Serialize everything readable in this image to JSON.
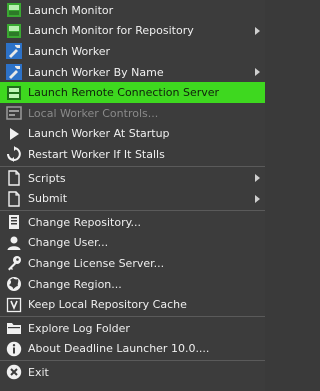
{
  "menu": {
    "items": [
      {
        "label": "Launch Monitor",
        "icon": "monitor-icon"
      },
      {
        "label": "Launch Monitor for Repository",
        "icon": "monitor-icon",
        "submenu": true
      },
      {
        "label": "Launch Worker",
        "icon": "worker-icon"
      },
      {
        "label": "Launch Worker By Name",
        "icon": "worker-icon",
        "submenu": true
      },
      {
        "label": "Launch Remote Connection Server",
        "icon": "server-icon",
        "highlighted": true
      },
      {
        "label": "Local Worker Controls...",
        "icon": "controls-icon",
        "disabled": true
      },
      {
        "label": "Launch Worker At Startup",
        "icon": "play-icon"
      },
      {
        "label": "Restart Worker If It Stalls",
        "icon": "restart-icon"
      },
      {
        "label": "Scripts",
        "icon": "file-icon",
        "submenu": true
      },
      {
        "label": "Submit",
        "icon": "file-icon",
        "submenu": true
      },
      {
        "label": "Change Repository...",
        "icon": "repository-icon"
      },
      {
        "label": "Change User...",
        "icon": "user-icon"
      },
      {
        "label": "Change License Server...",
        "icon": "key-icon"
      },
      {
        "label": "Change Region...",
        "icon": "globe-icon"
      },
      {
        "label": "Keep Local Repository Cache",
        "icon": "checkbox-icon"
      },
      {
        "label": "Explore Log Folder",
        "icon": "folder-icon"
      },
      {
        "label": "About Deadline Launcher 10.0....",
        "icon": "info-icon"
      },
      {
        "label": "Exit",
        "icon": "exit-icon"
      }
    ]
  },
  "colors": {
    "background": "#3c3c3c",
    "highlight": "#3ed81f",
    "text": "#f0f0f0",
    "disabled_text": "#8a8a8a"
  }
}
